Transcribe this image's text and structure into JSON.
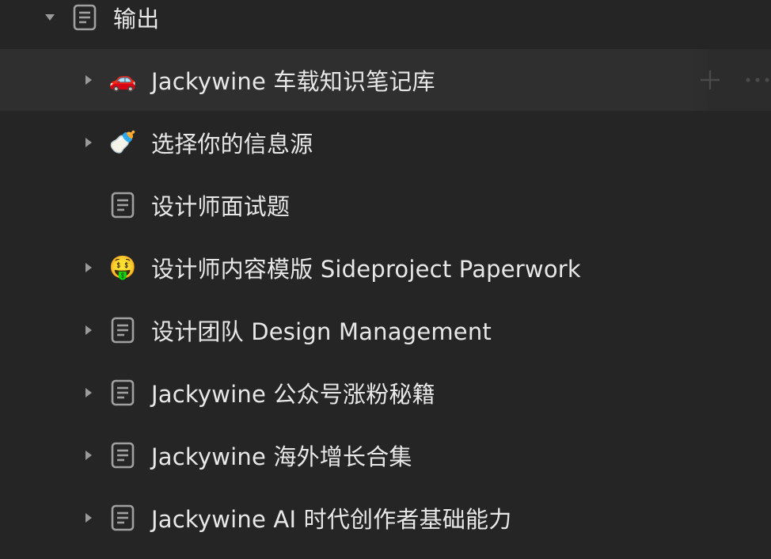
{
  "parent": {
    "label": "输出",
    "icon": "page-icon",
    "expanded": true
  },
  "children": [
    {
      "label": "Jackywine 车载知识笔记库",
      "icon": "car-emoji",
      "emoji": "🚗",
      "has_toggle": true
    },
    {
      "label": "选择你的信息源",
      "icon": "baby-bottle-emoji",
      "emoji": "🍼",
      "has_toggle": true
    },
    {
      "label": "设计师面试题",
      "icon": "page-icon",
      "has_toggle": false
    },
    {
      "label": "设计师内容模版 Sideproject Paperwork",
      "icon": "money-mouth-face-emoji",
      "emoji": "🤑",
      "has_toggle": true
    },
    {
      "label": "设计团队 Design Management",
      "icon": "page-icon",
      "has_toggle": true
    },
    {
      "label": "Jackywine 公众号涨粉秘籍",
      "icon": "page-icon",
      "has_toggle": true
    },
    {
      "label": "Jackywine 海外增长合集",
      "icon": "page-icon",
      "has_toggle": true
    },
    {
      "label": "Jackywine AI 时代创作者基础能力",
      "icon": "page-icon",
      "has_toggle": true
    }
  ],
  "row_actions": {
    "add_icon": "plus-icon",
    "more_icon": "more-icon"
  },
  "colors": {
    "background": "#252525",
    "hover_background": "#2f2f2f",
    "text": "#e8e8e8",
    "icon": "#a0a0a0"
  }
}
